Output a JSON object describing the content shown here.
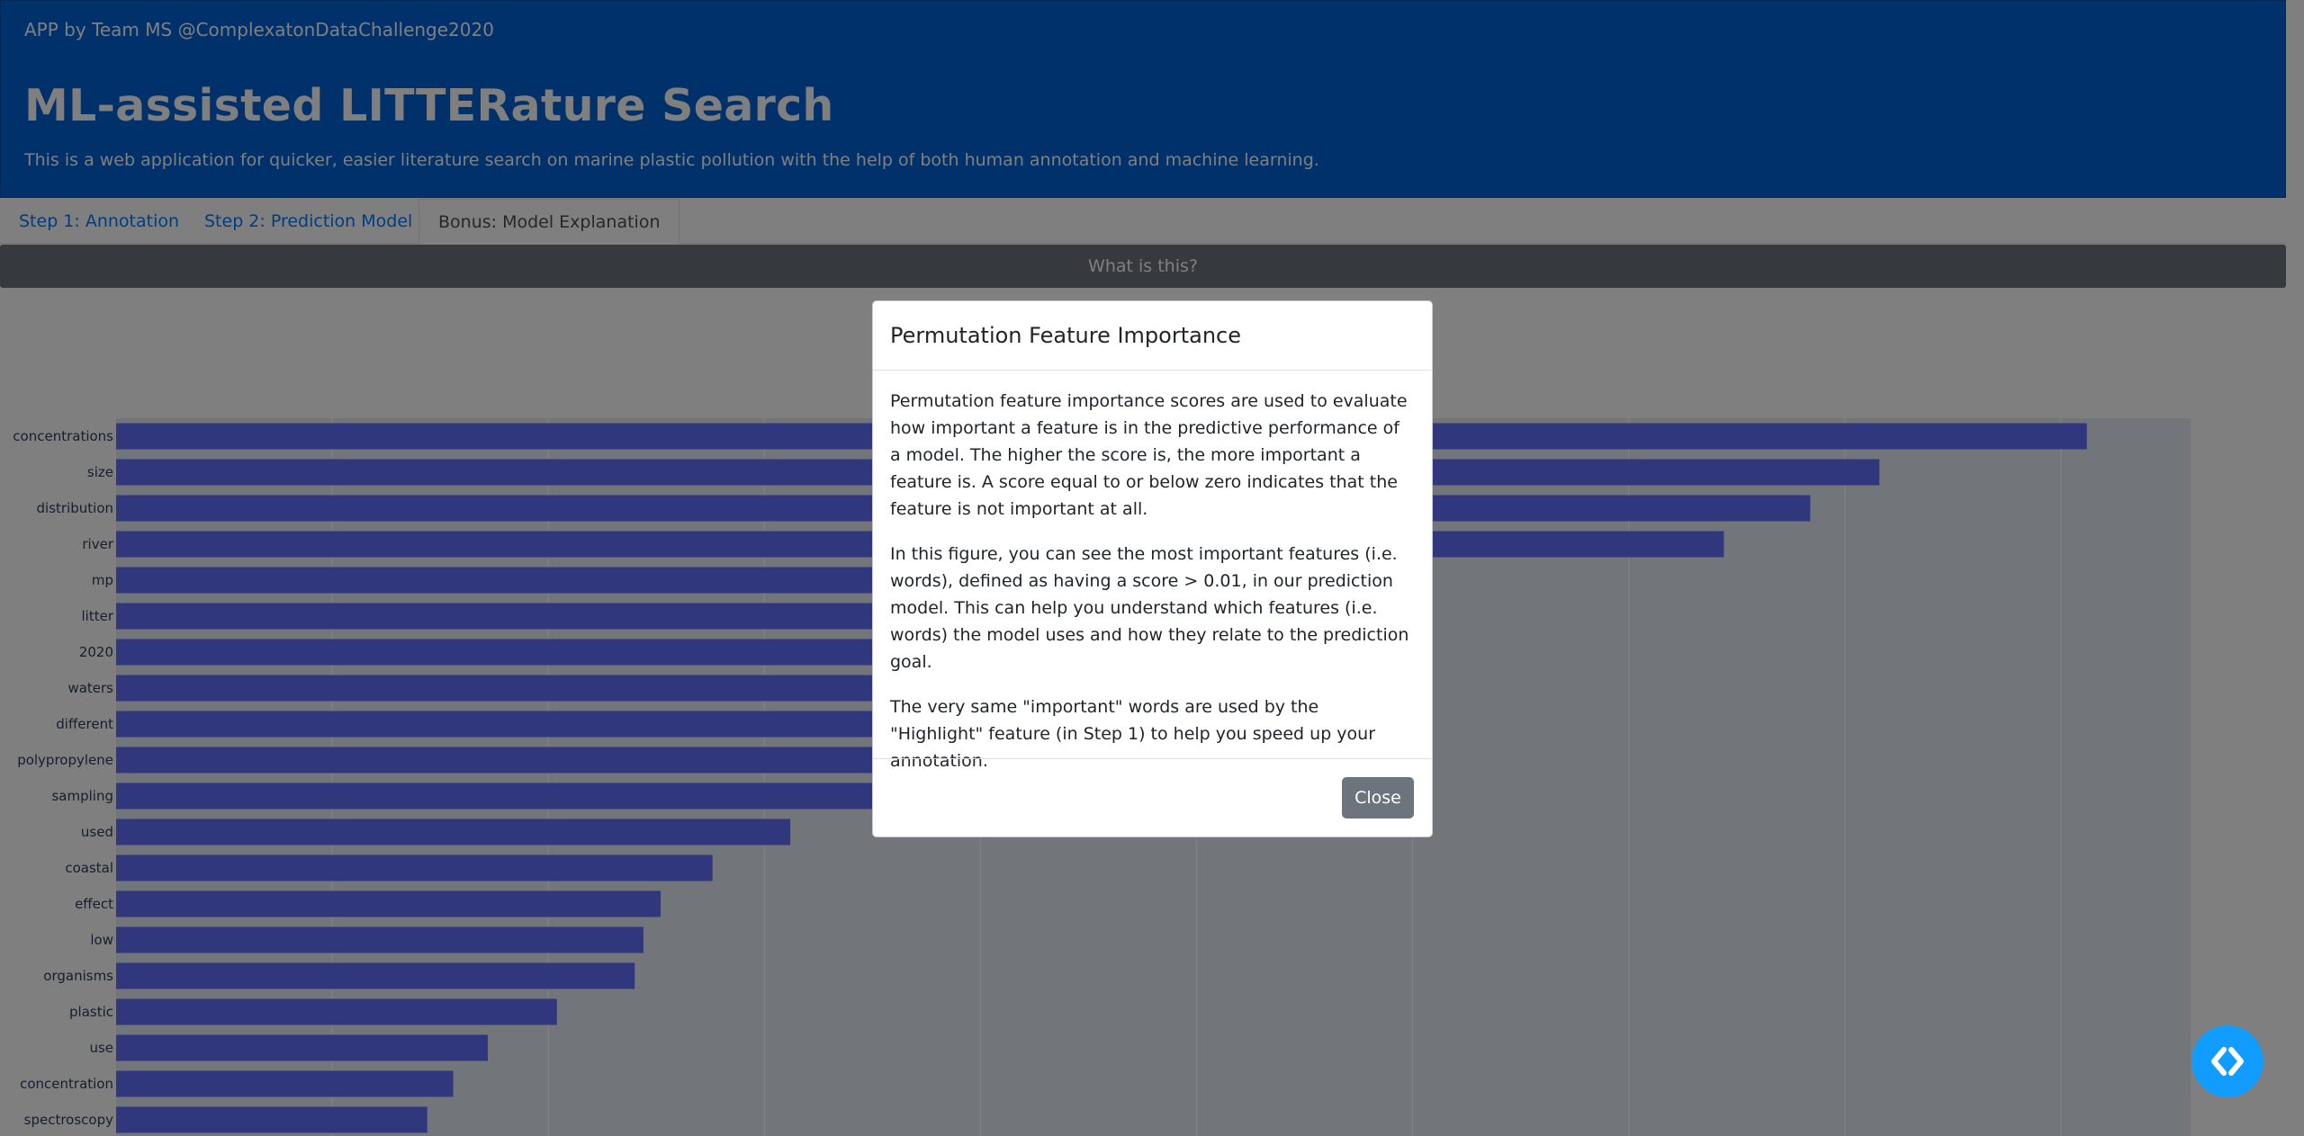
{
  "header": {
    "credit": "APP by Team MS @ComplexatonDataChallenge2020",
    "title": "ML-assisted LITTERature Search",
    "subtitle": "This is a web application for quicker, easier literature search on marine plastic pollution with the help of both human annotation and machine learning."
  },
  "tabs": [
    {
      "label": "Step 1: Annotation"
    },
    {
      "label": "Step 2: Prediction Model"
    },
    {
      "label": "Bonus: Model Explanation"
    }
  ],
  "info_bar": {
    "label": "What is this?"
  },
  "modal": {
    "title": "Permutation Feature Importance",
    "paragraphs": [
      "Permutation feature importance scores are used to evaluate how important a feature is in the predictive performance of a model. The higher the score is, the more important a feature is. A score equal to or below zero indicates that the feature is not important at all.",
      "In this figure, you can see the most important features (i.e. words), defined as having a score > 0.01, in our prediction model. This can help you understand which features (i.e. words) the model uses and how they relate to the prediction goal.",
      "The very same \"important\" words are used by the \"Highlight\" feature (in Step 1) to help you speed up your annotation."
    ],
    "close_label": "Close"
  },
  "colors": {
    "header_bg": "#0062d6",
    "bar": "#636efa",
    "plot_bg": "#e5ecf6",
    "close_button": "#6c757d",
    "info_bar": "#6c757d",
    "fab": "#119dff"
  },
  "icons": {
    "fab": "code-brackets-icon"
  },
  "chart_data": {
    "type": "bar",
    "orientation": "horizontal",
    "categories": [
      "concentrations",
      "size",
      "distribution",
      "river",
      "mp",
      "litter",
      "2020",
      "waters",
      "different",
      "polypropylene",
      "sampling",
      "used",
      "coastal",
      "effect",
      "low",
      "organisms",
      "plastic",
      "use",
      "concentration",
      "spectroscopy"
    ],
    "values": [
      2.28,
      2.04,
      1.96,
      1.86,
      1.44,
      0.95,
      0.95,
      0.95,
      0.95,
      0.95,
      0.95,
      0.78,
      0.69,
      0.63,
      0.61,
      0.6,
      0.51,
      0.43,
      0.39,
      0.36
    ],
    "xlim": [
      0,
      2.4
    ],
    "grid": true,
    "title": "",
    "xlabel": "",
    "ylabel": ""
  }
}
